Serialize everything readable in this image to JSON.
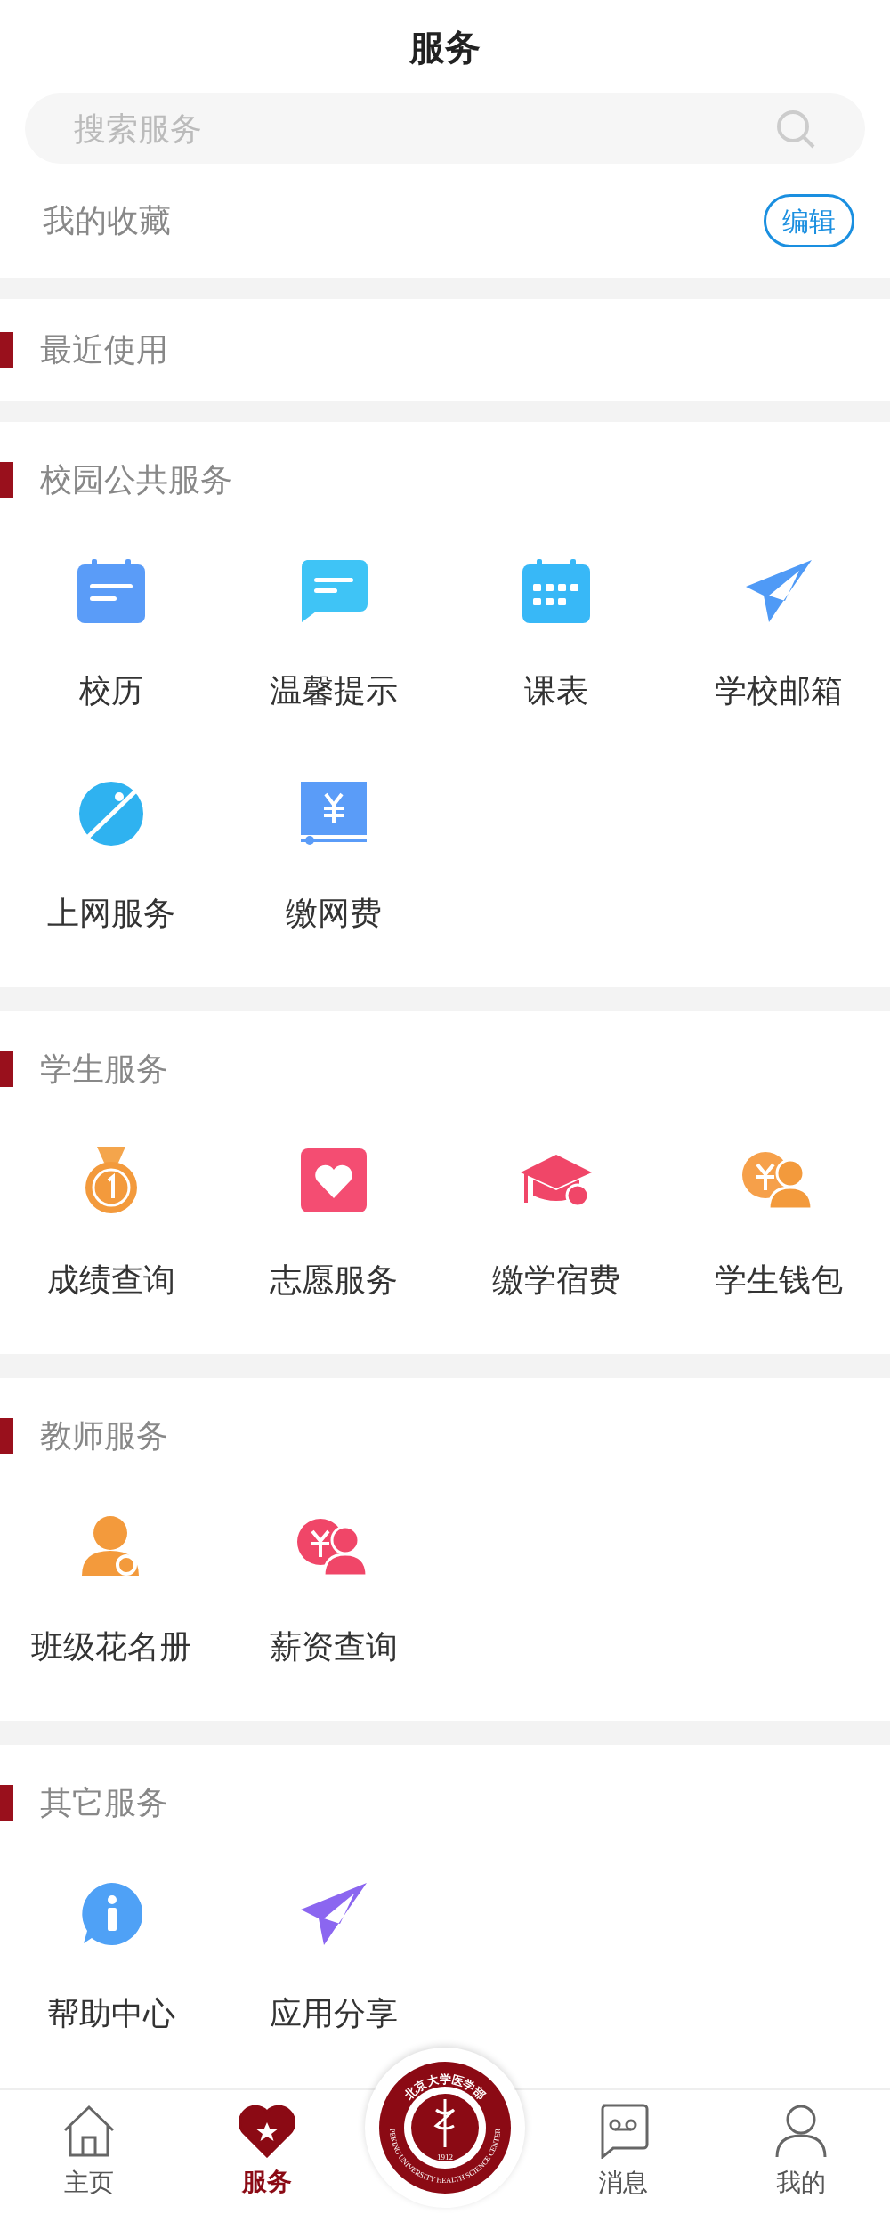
{
  "header": {
    "title": "服务"
  },
  "search": {
    "placeholder": "搜索服务"
  },
  "favorites": {
    "label": "我的收藏",
    "edit_button": "编辑"
  },
  "recent": {
    "title": "最近使用"
  },
  "sections": [
    {
      "title": "校园公共服务",
      "items": [
        "校历",
        "温馨提示",
        "课表",
        "学校邮箱",
        "上网服务",
        "缴网费"
      ]
    },
    {
      "title": "学生服务",
      "items": [
        "成绩查询",
        "志愿服务",
        "缴学宿费",
        "学生钱包"
      ]
    },
    {
      "title": "教师服务",
      "items": [
        "班级花名册",
        "薪资查询"
      ]
    },
    {
      "title": "其它服务",
      "items": [
        "帮助中心",
        "应用分享"
      ]
    }
  ],
  "emblem": {
    "top_text": "北京大学医学部",
    "ring_text": "PEKING UNIVERSITY HEALTH SCIENCE CENTER",
    "year": "1912"
  },
  "bottom_nav": [
    {
      "label": "主页",
      "selected": false
    },
    {
      "label": "服务",
      "selected": true
    },
    {
      "label": "消息",
      "selected": false
    },
    {
      "label": "我的",
      "selected": false
    }
  ]
}
